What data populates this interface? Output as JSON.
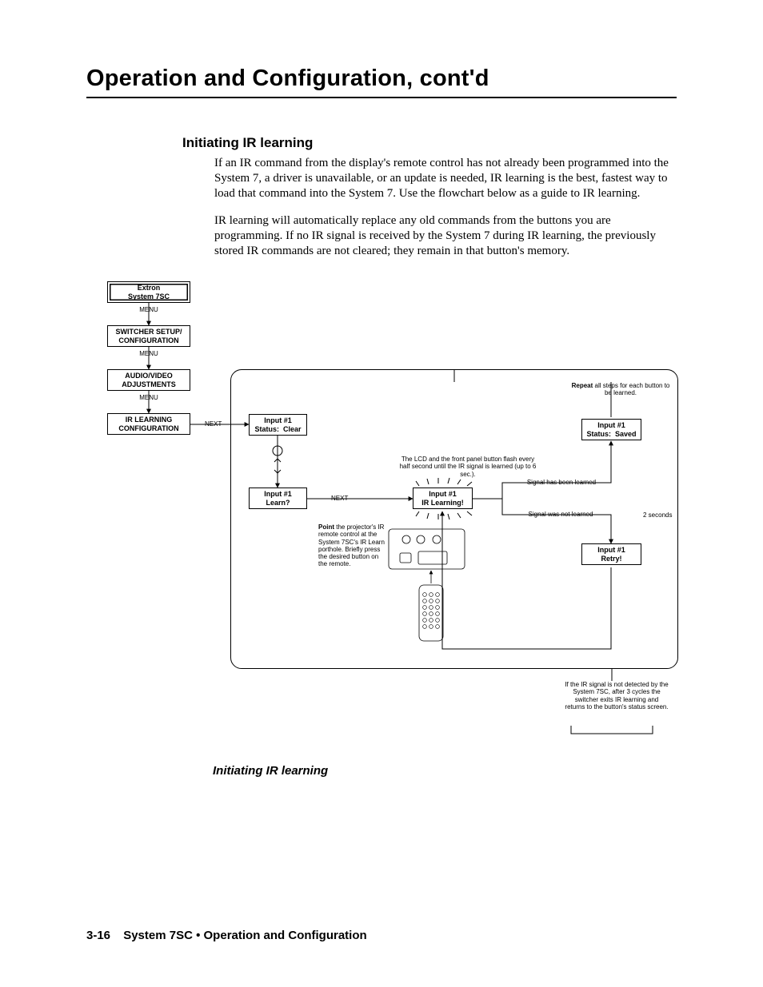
{
  "chapter_title": "Operation and Configuration, cont'd",
  "section_heading": "Initiating IR learning",
  "para1": "If an IR command from the display's remote control has not already been programmed into the System 7, a driver is unavailable, or an update is needed, IR learning is the best, fastest way to load that command into the System 7.  Use the flowchart below as a guide to IR learning.",
  "para2": "IR learning will automatically replace any old commands from the buttons you are programming.  If no IR signal is received by the System 7 during IR learning, the previously stored IR commands are not cleared; they remain in that button's memory.",
  "figure_caption": "Initiating IR learning",
  "footer": {
    "page": "3-16",
    "product": "System 7SC",
    "section": "Operation and Configuration"
  },
  "flow": {
    "box_extron": "Extron\nSystem 7SC",
    "menu": "MENU",
    "box_switcher": "SWITCHER SETUP/\nCONFIGURATION",
    "box_av": "AUDIO/VIDEO\nADJUSTMENTS",
    "box_irconf": "IR LEARNING\nCONFIGURATION",
    "next": "NEXT",
    "box_status_clear": "Input #1\nStatus:  Clear",
    "box_learn": "Input #1\nLearn?",
    "box_learning": "Input #1\nIR Learning!",
    "box_status_saved": "Input #1\nStatus:  Saved",
    "box_retry": "Input #1\nRetry!",
    "repeat_note": "Repeat all steps for each button to be learned.",
    "lcd_note": "The LCD and the front panel button flash every half second until the IR signal is learned (up to 6 sec.).",
    "point_note": "Point the projector's IR remote control at the System 7SC's IR Learn porthole. Briefly press the desired button on the remote.",
    "sig_learned": "Signal has been learned",
    "sig_not_learned": "Signal was not learned",
    "two_sec": "2 seconds",
    "exit_note": "If the IR signal is not detected by the System 7SC, after 3 cycles the switcher exits IR learning and returns to the button's status screen."
  }
}
